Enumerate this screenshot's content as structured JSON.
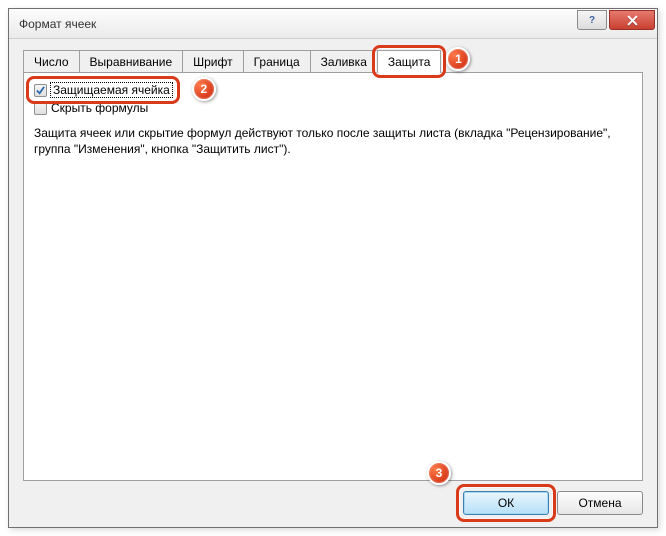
{
  "window": {
    "title": "Формат ячеек"
  },
  "tabs": {
    "items": [
      {
        "label": "Число"
      },
      {
        "label": "Выравнивание"
      },
      {
        "label": "Шрифт"
      },
      {
        "label": "Граница"
      },
      {
        "label": "Заливка"
      },
      {
        "label": "Защита"
      }
    ],
    "active_index": 5
  },
  "panel": {
    "check_protected": {
      "label": "Защищаемая ячейка",
      "checked": true
    },
    "check_hide": {
      "label": "Скрыть формулы",
      "checked": false
    },
    "description": "Защита ячеек или скрытие формул действуют только после защиты листа (вкладка \"Рецензирование\", группа \"Изменения\", кнопка \"Защитить лист\")."
  },
  "buttons": {
    "ok": "ОК",
    "cancel": "Отмена"
  },
  "markers": {
    "m1": "1",
    "m2": "2",
    "m3": "3"
  }
}
